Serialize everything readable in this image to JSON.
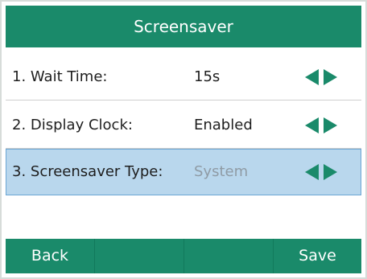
{
  "screen": {
    "title": "Screensaver",
    "accent_color": "#1a8a6a",
    "highlight_color": "#b9d7ed"
  },
  "settings": [
    {
      "label": "1. Wait Time:",
      "value": "15s",
      "selected": false
    },
    {
      "label": "2. Display Clock:",
      "value": "Enabled",
      "selected": false
    },
    {
      "label": "3. Screensaver Type:",
      "value": "System",
      "selected": true
    }
  ],
  "softkeys": [
    {
      "label": "Back"
    },
    {
      "label": ""
    },
    {
      "label": ""
    },
    {
      "label": "Save"
    }
  ],
  "icons": {
    "left": "arrow-left-icon",
    "right": "arrow-right-icon"
  }
}
